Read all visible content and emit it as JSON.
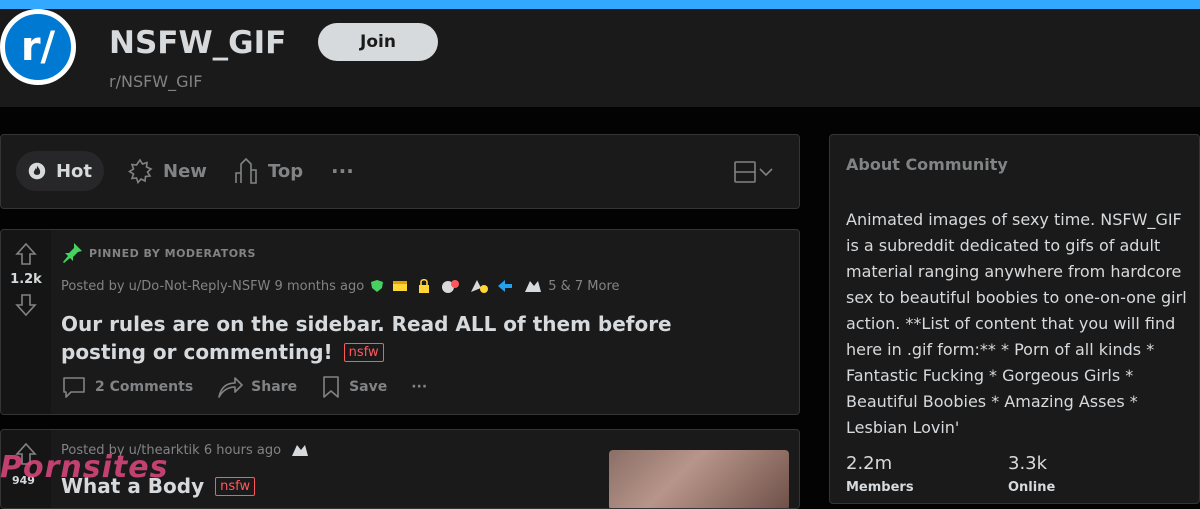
{
  "header": {
    "avatar_text": "r/",
    "title": "NSFW_GIF",
    "subname": "r/NSFW_GIF",
    "join_label": "Join"
  },
  "sort": {
    "hot": "Hot",
    "new": "New",
    "top": "Top",
    "more": "···"
  },
  "posts": [
    {
      "votes": "1.2k",
      "pinned_label": "PINNED BY MODERATORS",
      "meta": "Posted by u/Do-Not-Reply-NSFW 9 months ago",
      "awards_more": "5 & 7 More",
      "title": "Our rules are on the sidebar. Read ALL of them before posting or commenting!",
      "tag": "nsfw",
      "comments": "2 Comments",
      "share": "Share",
      "save": "Save",
      "more": "···"
    },
    {
      "votes": "949",
      "meta": "Posted by u/thearktik 6 hours ago",
      "title": "What a Body",
      "tag": "nsfw"
    }
  ],
  "watermark": "Pornsites",
  "sidebar": {
    "heading": "About Community",
    "description": "Animated images of sexy time. NSFW_GIF is a subreddit dedicated to gifs of adult material ranging anywhere from hardcore sex to beautiful boobies to one-on-one girl action. **List of content that you will find here in .gif form:** * Porn of all kinds * Fantastic Fucking * Gorgeous Girls * Beautiful Boobies * Amazing Asses * Lesbian Lovin'",
    "members_count": "2.2m",
    "members_label": "Members",
    "online_count": "3.3k",
    "online_label": "Online"
  },
  "colors": {
    "accent_bar": "#33a8ff",
    "nsfw": "#ff585b",
    "card": "#1a1a1b"
  }
}
